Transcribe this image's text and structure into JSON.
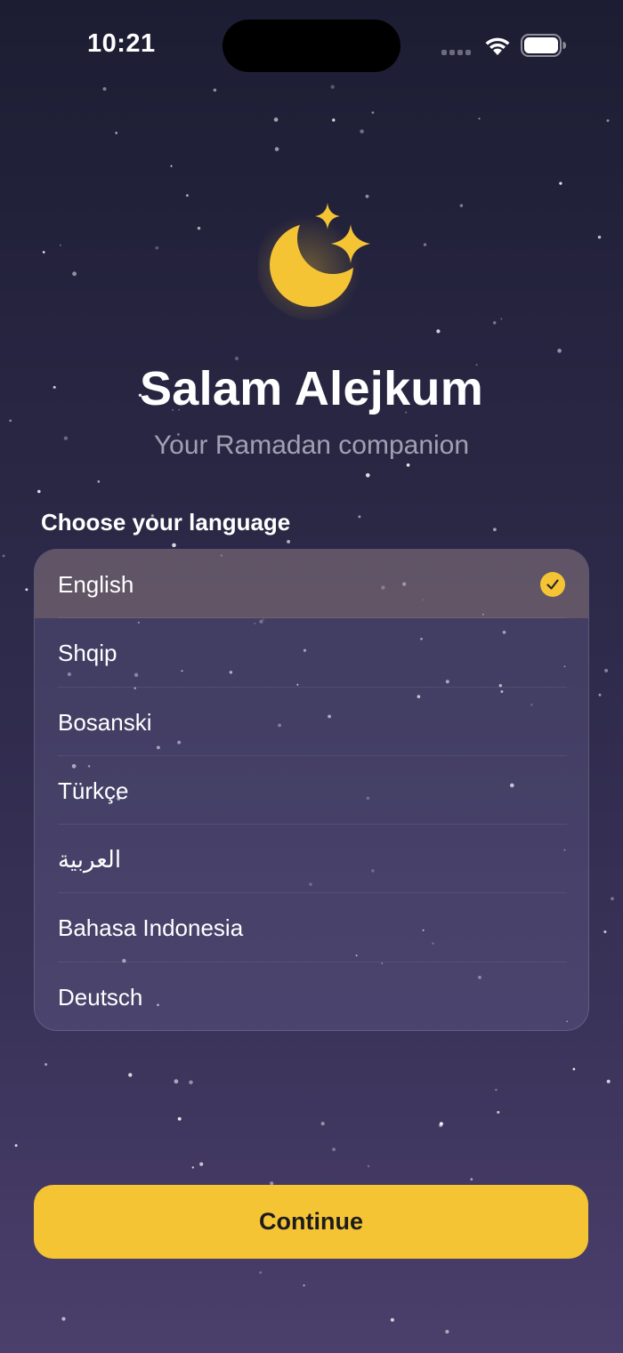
{
  "status_bar": {
    "time": "10:21",
    "icons": [
      "signal-icon",
      "wifi-icon",
      "battery-icon"
    ]
  },
  "hero": {
    "icon": "moon-stars-icon",
    "title": "Salam Alejkum",
    "subtitle": "Your Ramadan companion"
  },
  "language_section": {
    "label": "Choose your language",
    "selected": "English",
    "options": [
      {
        "label": "English",
        "selected": true
      },
      {
        "label": "Shqip",
        "selected": false
      },
      {
        "label": "Bosanski",
        "selected": false
      },
      {
        "label": "Türkçe",
        "selected": false
      },
      {
        "label": "العربية",
        "selected": false
      },
      {
        "label": "Bahasa Indonesia",
        "selected": false
      },
      {
        "label": "Deutsch",
        "selected": false
      }
    ]
  },
  "continue_button": {
    "label": "Continue"
  },
  "colors": {
    "accent": "#f4c434",
    "background_top": "#1c1d33",
    "background_bottom": "#4b3f6c",
    "selected_row": "#5a4d4f",
    "check": "#f4c434"
  }
}
